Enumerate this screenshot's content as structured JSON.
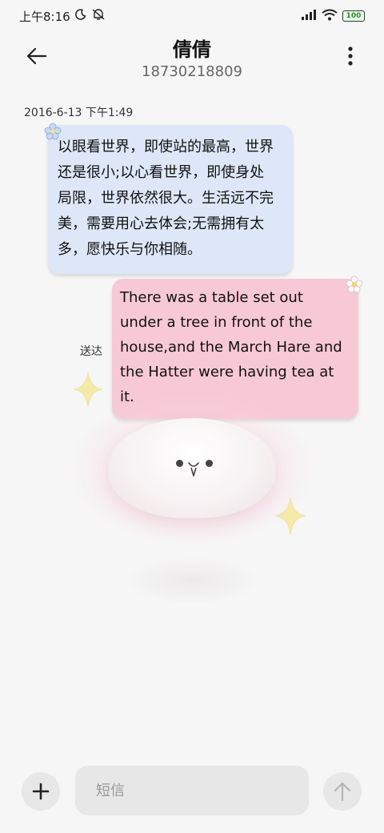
{
  "status_bar": {
    "time": "上午8:16",
    "battery": "100",
    "icons": [
      "moon-icon",
      "mute-icon",
      "signal-icon",
      "wifi-icon",
      "battery-icon"
    ]
  },
  "header": {
    "contact_name": "倩倩",
    "contact_number": "18730218809",
    "icons": [
      "back-arrow-icon",
      "more-vertical-icon"
    ]
  },
  "conversation": {
    "timestamp": "2016-6-13 下午1:49",
    "incoming": {
      "lines": [
        "以眼看世界，即使站的最高，世界",
        "还是很小;以心看世界，即使身处",
        "局限，世界依然很大。生活远不完",
        "美，需要用心去体会;无需拥有太",
        "多，愿快乐与你相随。"
      ]
    },
    "outgoing": {
      "lines": [
        "There was a table set out",
        "under a tree in front of the",
        "house,and the March Hare and",
        "the Hatter were having tea at",
        "it."
      ],
      "status": "送达"
    }
  },
  "composer": {
    "placeholder": "短信",
    "icons": [
      "plus-icon",
      "send-arrow-icon"
    ]
  },
  "colors": {
    "incoming_bubble": "#dde7f7",
    "outgoing_bubble": "#f7c8d6",
    "background": "#f6f6f6"
  }
}
